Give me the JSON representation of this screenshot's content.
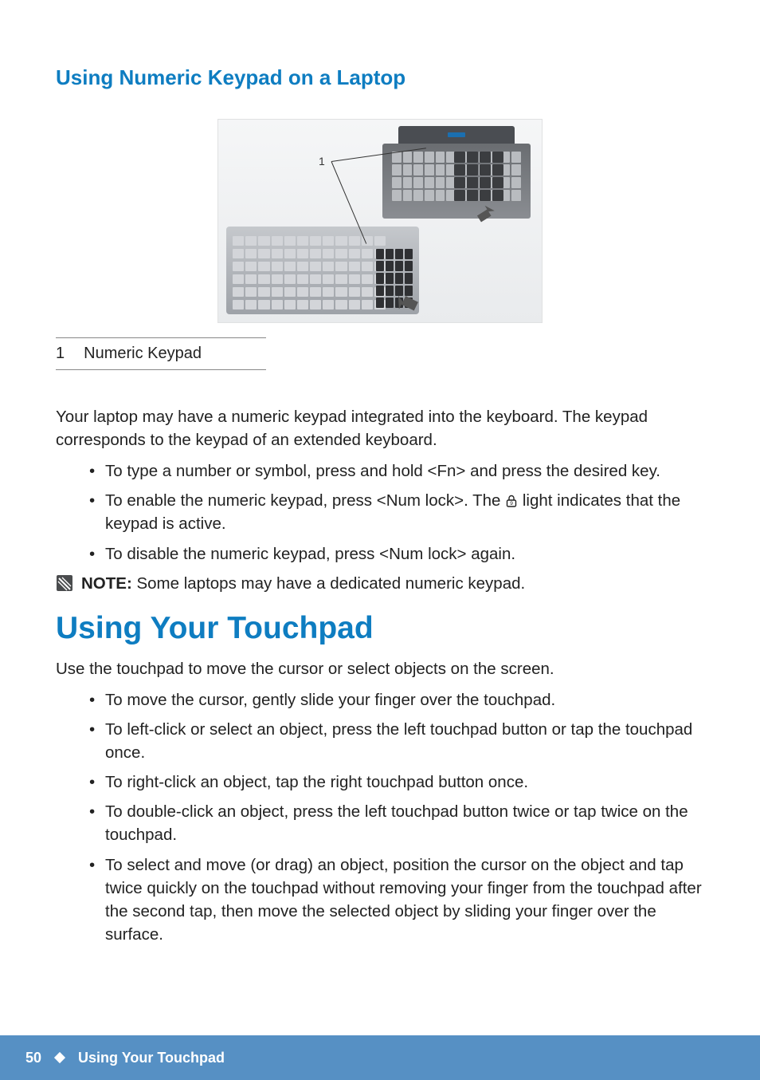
{
  "heading_keypad": "Using Numeric Keypad on a Laptop",
  "callout_number": "1",
  "legend": {
    "num": "1",
    "label": "Numeric Keypad"
  },
  "keypad_intro": "Your laptop may have a numeric keypad integrated into the keyboard. The keypad corresponds to the keypad of an extended keyboard.",
  "keypad_bullets": [
    "To type a number or symbol, press and hold <Fn> and press the desired key.",
    {
      "pre": "To enable the numeric keypad, press <Num lock>. The ",
      "post": " light indicates that the keypad is active."
    },
    "To disable the numeric keypad, press <Num lock> again."
  ],
  "note_label": "NOTE:",
  "note_text": " Some laptops may have a dedicated numeric keypad.",
  "heading_touchpad": "Using Your Touchpad",
  "touchpad_intro": "Use the touchpad to move the cursor or select objects on the screen.",
  "touchpad_bullets": [
    "To move the cursor, gently slide your finger over the touchpad.",
    "To left-click or select an object, press the left touchpad button or tap the touchpad once.",
    "To right-click an object, tap the right touchpad button once.",
    "To double-click an object, press the left touchpad button twice or tap twice on the touchpad.",
    "To select and move (or drag) an object, position the cursor on the object and tap twice quickly on the touchpad without removing your finger from the touchpad after the second tap, then move the selected object by sliding your finger over the surface."
  ],
  "footer": {
    "page": "50",
    "chapter": "Using Your Touchpad"
  }
}
